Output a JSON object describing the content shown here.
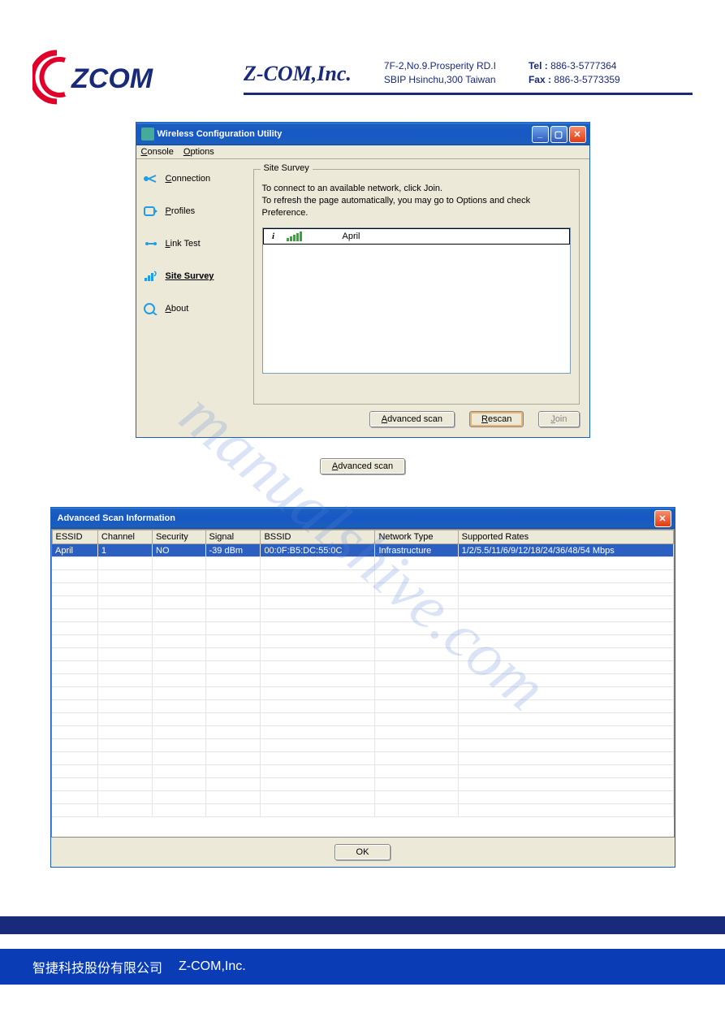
{
  "header": {
    "company": "Z-COM,Inc.",
    "address_line1": "7F-2,No.9.Prosperity RD.I",
    "address_line2": "SBIP Hsinchu,300 Taiwan",
    "tel_label": "Tel :",
    "tel": "886-3-5777364",
    "fax_label": "Fax :",
    "fax": "886-3-5773359"
  },
  "window1": {
    "title": "Wireless Configuration Utility",
    "menu": {
      "console": "Console",
      "options": "Options"
    },
    "sidebar": {
      "items": [
        {
          "label": "Connection",
          "accel": "C"
        },
        {
          "label": "Profiles",
          "accel": "P"
        },
        {
          "label": "Link Test",
          "accel": "L"
        },
        {
          "label": "Site Survey",
          "accel": "S",
          "selected": true
        },
        {
          "label": "About",
          "accel": "A"
        }
      ]
    },
    "group": {
      "legend": "Site Survey",
      "help1": "To connect to an available network, click Join.",
      "help2": "To refresh the page automatically, you may go to Options and check Preference."
    },
    "networks": [
      {
        "ssid": "April"
      }
    ],
    "buttons": {
      "advanced": "Advanced scan",
      "rescan": "Rescan",
      "join": "Join"
    }
  },
  "standalone_button": "Advanced scan",
  "window2": {
    "title": "Advanced Scan Information",
    "columns": [
      "ESSID",
      "Channel",
      "Security",
      "Signal",
      "BSSID",
      "Network Type",
      "Supported Rates"
    ],
    "rows": [
      {
        "essid": "April",
        "channel": "1",
        "security": "NO",
        "signal": "-39 dBm",
        "bssid": "00:0F:B5:DC:55:0C",
        "net_type": "Infrastructure",
        "rates": "1/2/5.5/11/6/9/12/18/24/36/48/54 Mbps"
      }
    ],
    "ok": "OK"
  },
  "watermark": "manualshive.com",
  "footer": {
    "cjk": "智捷科技股份有限公司",
    "company": "Z-COM,Inc."
  }
}
